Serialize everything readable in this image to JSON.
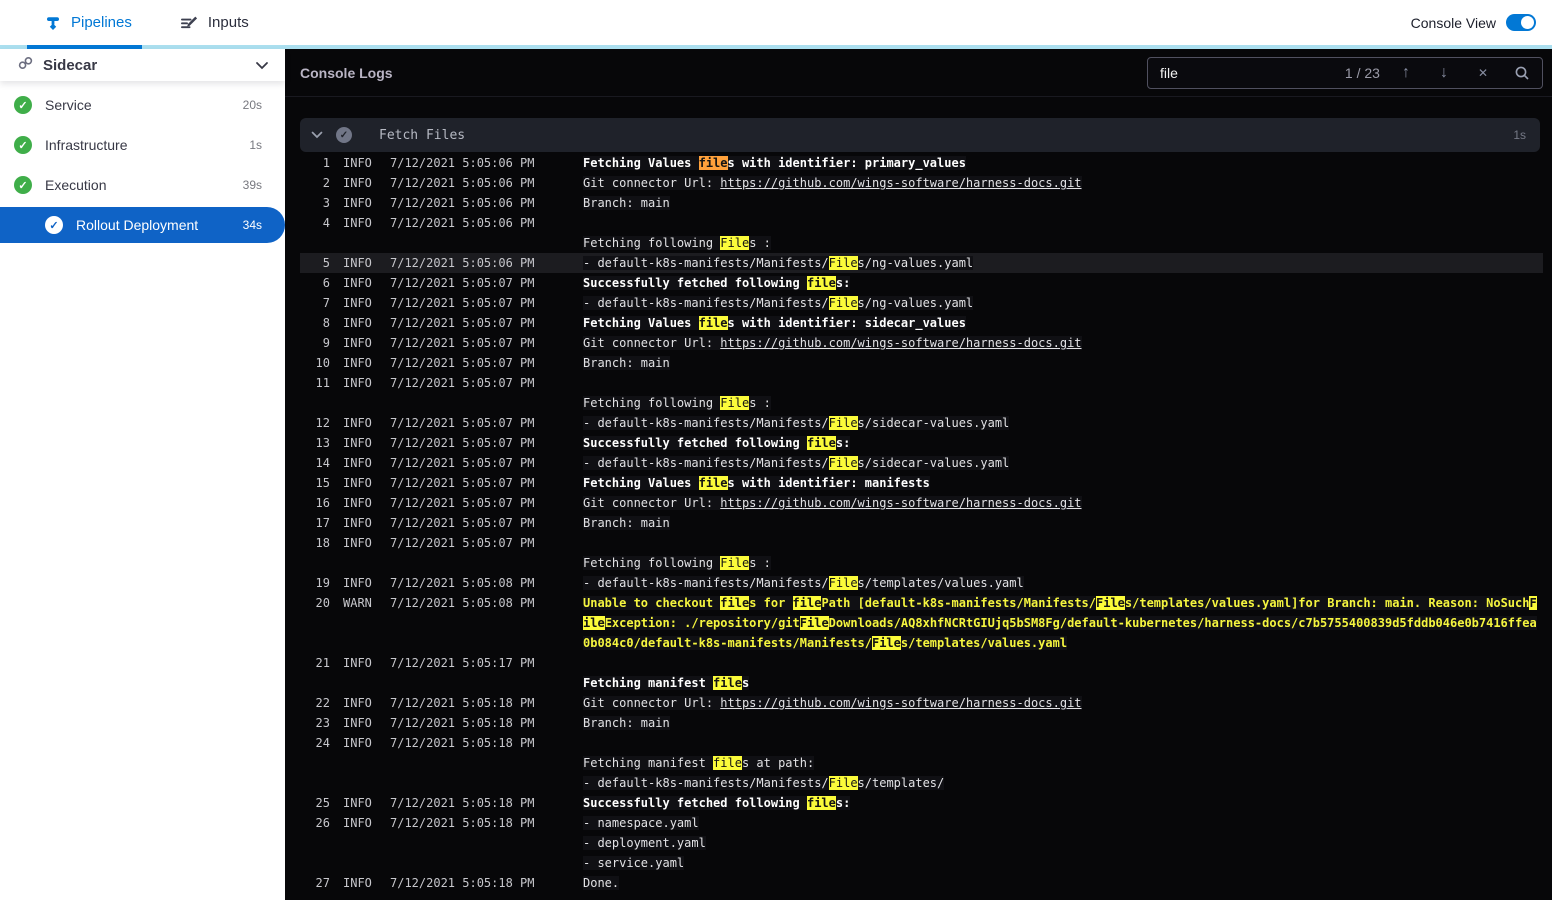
{
  "topbar": {
    "tabs": [
      {
        "label": "Pipelines"
      },
      {
        "label": "Inputs"
      }
    ],
    "active_tab": "Pipelines",
    "console_view_label": "Console View",
    "accent_color": "#0278d5",
    "tab_underline_color": "#abdfef"
  },
  "sidebar": {
    "title": "Sidecar",
    "items": [
      {
        "label": "Service",
        "duration": "20s",
        "status": "success",
        "selected": false,
        "indent": false
      },
      {
        "label": "Infrastructure",
        "duration": "1s",
        "status": "success",
        "selected": false,
        "indent": false
      },
      {
        "label": "Execution",
        "duration": "39s",
        "status": "success",
        "selected": false,
        "indent": false
      },
      {
        "label": "Rollout Deployment",
        "duration": "34s",
        "status": "success",
        "selected": true,
        "indent": true
      }
    ],
    "success_color": "#3fae49",
    "selected_color": "#0f63c6"
  },
  "console": {
    "title": "Console Logs",
    "search": {
      "value": "file",
      "counter": "1 / 23"
    },
    "section": {
      "title": "Fetch Files",
      "duration": "1s",
      "status": "success"
    },
    "colors": {
      "match": "#fbfb3a",
      "current_match": "#ffa13b",
      "warn_text": "#f5f53f",
      "background": "#070709"
    },
    "rows": [
      {
        "num": "1",
        "level": "INFO",
        "time": "7/12/2021 5:05:06 PM",
        "style": "bold",
        "sel": false,
        "seg": [
          [
            "Fetching Values ",
            ""
          ],
          [
            "file",
            "cur"
          ],
          [
            "s with identifier: primary_values",
            ""
          ]
        ]
      },
      {
        "num": "2",
        "level": "INFO",
        "time": "7/12/2021 5:05:06 PM",
        "style": "",
        "sel": false,
        "seg": [
          [
            "Git connector Url: ",
            ""
          ],
          [
            "https://github.com/wings-software/harness-docs.git",
            "link"
          ]
        ]
      },
      {
        "num": "3",
        "level": "INFO",
        "time": "7/12/2021 5:05:06 PM",
        "style": "",
        "sel": false,
        "seg": [
          [
            "Branch: main",
            ""
          ]
        ]
      },
      {
        "num": "4",
        "level": "INFO",
        "time": "7/12/2021 5:05:06 PM",
        "style": "",
        "sel": false,
        "seg": []
      },
      {
        "num": "",
        "level": "",
        "time": "",
        "style": "",
        "sel": false,
        "seg": [
          [
            "Fetching following ",
            ""
          ],
          [
            "File",
            "hl"
          ],
          [
            "s :",
            ""
          ]
        ]
      },
      {
        "num": "5",
        "level": "INFO",
        "time": "7/12/2021 5:05:06 PM",
        "style": "",
        "sel": true,
        "seg": [
          [
            "- default-k8s-manifests/Manifests/",
            ""
          ],
          [
            "File",
            "hl"
          ],
          [
            "s/ng-values.yaml",
            ""
          ]
        ]
      },
      {
        "num": "6",
        "level": "INFO",
        "time": "7/12/2021 5:05:07 PM",
        "style": "bold",
        "sel": false,
        "seg": [
          [
            "Successfully fetched following ",
            ""
          ],
          [
            "file",
            "hl"
          ],
          [
            "s:",
            ""
          ]
        ]
      },
      {
        "num": "7",
        "level": "INFO",
        "time": "7/12/2021 5:05:07 PM",
        "style": "",
        "sel": false,
        "seg": [
          [
            "- default-k8s-manifests/Manifests/",
            ""
          ],
          [
            "File",
            "hl"
          ],
          [
            "s/ng-values.yaml",
            ""
          ]
        ]
      },
      {
        "num": "8",
        "level": "INFO",
        "time": "7/12/2021 5:05:07 PM",
        "style": "bold",
        "sel": false,
        "seg": [
          [
            "Fetching Values ",
            ""
          ],
          [
            "file",
            "hl"
          ],
          [
            "s with identifier: sidecar_values",
            ""
          ]
        ]
      },
      {
        "num": "9",
        "level": "INFO",
        "time": "7/12/2021 5:05:07 PM",
        "style": "",
        "sel": false,
        "seg": [
          [
            "Git connector Url: ",
            ""
          ],
          [
            "https://github.com/wings-software/harness-docs.git",
            "link"
          ]
        ]
      },
      {
        "num": "10",
        "level": "INFO",
        "time": "7/12/2021 5:05:07 PM",
        "style": "",
        "sel": false,
        "seg": [
          [
            "Branch: main",
            ""
          ]
        ]
      },
      {
        "num": "11",
        "level": "INFO",
        "time": "7/12/2021 5:05:07 PM",
        "style": "",
        "sel": false,
        "seg": []
      },
      {
        "num": "",
        "level": "",
        "time": "",
        "style": "",
        "sel": false,
        "seg": [
          [
            "Fetching following ",
            ""
          ],
          [
            "File",
            "hl"
          ],
          [
            "s :",
            ""
          ]
        ]
      },
      {
        "num": "12",
        "level": "INFO",
        "time": "7/12/2021 5:05:07 PM",
        "style": "",
        "sel": false,
        "seg": [
          [
            "- default-k8s-manifests/Manifests/",
            ""
          ],
          [
            "File",
            "hl"
          ],
          [
            "s/sidecar-values.yaml",
            ""
          ]
        ]
      },
      {
        "num": "13",
        "level": "INFO",
        "time": "7/12/2021 5:05:07 PM",
        "style": "bold",
        "sel": false,
        "seg": [
          [
            "Successfully fetched following ",
            ""
          ],
          [
            "file",
            "hl"
          ],
          [
            "s:",
            ""
          ]
        ]
      },
      {
        "num": "14",
        "level": "INFO",
        "time": "7/12/2021 5:05:07 PM",
        "style": "",
        "sel": false,
        "seg": [
          [
            "- default-k8s-manifests/Manifests/",
            ""
          ],
          [
            "File",
            "hl"
          ],
          [
            "s/sidecar-values.yaml",
            ""
          ]
        ]
      },
      {
        "num": "15",
        "level": "INFO",
        "time": "7/12/2021 5:05:07 PM",
        "style": "bold",
        "sel": false,
        "seg": [
          [
            "Fetching Values ",
            ""
          ],
          [
            "file",
            "hl"
          ],
          [
            "s with identifier: manifests",
            ""
          ]
        ]
      },
      {
        "num": "16",
        "level": "INFO",
        "time": "7/12/2021 5:05:07 PM",
        "style": "",
        "sel": false,
        "seg": [
          [
            "Git connector Url: ",
            ""
          ],
          [
            "https://github.com/wings-software/harness-docs.git",
            "link"
          ]
        ]
      },
      {
        "num": "17",
        "level": "INFO",
        "time": "7/12/2021 5:05:07 PM",
        "style": "",
        "sel": false,
        "seg": [
          [
            "Branch: main",
            ""
          ]
        ]
      },
      {
        "num": "18",
        "level": "INFO",
        "time": "7/12/2021 5:05:07 PM",
        "style": "",
        "sel": false,
        "seg": []
      },
      {
        "num": "",
        "level": "",
        "time": "",
        "style": "",
        "sel": false,
        "seg": [
          [
            "Fetching following ",
            ""
          ],
          [
            "File",
            "hl"
          ],
          [
            "s :",
            ""
          ]
        ]
      },
      {
        "num": "19",
        "level": "INFO",
        "time": "7/12/2021 5:05:08 PM",
        "style": "",
        "sel": false,
        "seg": [
          [
            "- default-k8s-manifests/Manifests/",
            ""
          ],
          [
            "File",
            "hl"
          ],
          [
            "s/templates/values.yaml",
            ""
          ]
        ]
      },
      {
        "num": "20",
        "level": "WARN",
        "time": "7/12/2021 5:05:08 PM",
        "style": "warn",
        "sel": false,
        "seg": [
          [
            "Unable to checkout ",
            ""
          ],
          [
            "file",
            "hl"
          ],
          [
            "s for ",
            ""
          ],
          [
            "file",
            "hl"
          ],
          [
            "Path [default-k8s-manifests/Manifests/",
            ""
          ],
          [
            "File",
            "hl"
          ],
          [
            "s/templates/values.yaml]for Branch: main. Reason: NoSuch",
            ""
          ],
          [
            "F",
            "hl"
          ]
        ]
      },
      {
        "num": "",
        "level": "",
        "time": "",
        "style": "warn",
        "sel": false,
        "seg": [
          [
            "ile",
            "hl"
          ],
          [
            "Exception: ./repository/git",
            ""
          ],
          [
            "File",
            "hl"
          ],
          [
            "Downloads/AQ8xhfNCRtGIUjq5bSM8Fg/default-kubernetes/harness-docs/c7b5755400839d5fddb046e0b7416ffea",
            ""
          ]
        ]
      },
      {
        "num": "",
        "level": "",
        "time": "",
        "style": "warn",
        "sel": false,
        "seg": [
          [
            "0b084c0/default-k8s-manifests/Manifests/",
            ""
          ],
          [
            "File",
            "hl"
          ],
          [
            "s/templates/values.yaml",
            ""
          ]
        ]
      },
      {
        "num": "21",
        "level": "INFO",
        "time": "7/12/2021 5:05:17 PM",
        "style": "",
        "sel": false,
        "seg": []
      },
      {
        "num": "",
        "level": "",
        "time": "",
        "style": "bold",
        "sel": false,
        "seg": [
          [
            "Fetching manifest ",
            ""
          ],
          [
            "file",
            "hl"
          ],
          [
            "s",
            ""
          ]
        ]
      },
      {
        "num": "22",
        "level": "INFO",
        "time": "7/12/2021 5:05:18 PM",
        "style": "",
        "sel": false,
        "seg": [
          [
            "Git connector Url: ",
            ""
          ],
          [
            "https://github.com/wings-software/harness-docs.git",
            "link"
          ]
        ]
      },
      {
        "num": "23",
        "level": "INFO",
        "time": "7/12/2021 5:05:18 PM",
        "style": "",
        "sel": false,
        "seg": [
          [
            "Branch: main",
            ""
          ]
        ]
      },
      {
        "num": "24",
        "level": "INFO",
        "time": "7/12/2021 5:05:18 PM",
        "style": "",
        "sel": false,
        "seg": []
      },
      {
        "num": "",
        "level": "",
        "time": "",
        "style": "",
        "sel": false,
        "seg": [
          [
            "Fetching manifest ",
            ""
          ],
          [
            "file",
            "hl"
          ],
          [
            "s at path:",
            ""
          ]
        ]
      },
      {
        "num": "",
        "level": "",
        "time": "",
        "style": "",
        "sel": false,
        "seg": [
          [
            "- default-k8s-manifests/Manifests/",
            ""
          ],
          [
            "File",
            "hl"
          ],
          [
            "s/templates/",
            ""
          ]
        ]
      },
      {
        "num": "25",
        "level": "INFO",
        "time": "7/12/2021 5:05:18 PM",
        "style": "bold",
        "sel": false,
        "seg": [
          [
            "Successfully fetched following ",
            ""
          ],
          [
            "file",
            "hl"
          ],
          [
            "s:",
            ""
          ]
        ]
      },
      {
        "num": "26",
        "level": "INFO",
        "time": "7/12/2021 5:05:18 PM",
        "style": "",
        "sel": false,
        "seg": [
          [
            "- namespace.yaml",
            ""
          ]
        ]
      },
      {
        "num": "",
        "level": "",
        "time": "",
        "style": "",
        "sel": false,
        "seg": [
          [
            "- deployment.yaml",
            ""
          ]
        ]
      },
      {
        "num": "",
        "level": "",
        "time": "",
        "style": "",
        "sel": false,
        "seg": [
          [
            "- service.yaml",
            ""
          ]
        ]
      },
      {
        "num": "27",
        "level": "INFO",
        "time": "7/12/2021 5:05:18 PM",
        "style": "",
        "sel": false,
        "seg": [
          [
            "Done.",
            ""
          ]
        ]
      }
    ]
  }
}
